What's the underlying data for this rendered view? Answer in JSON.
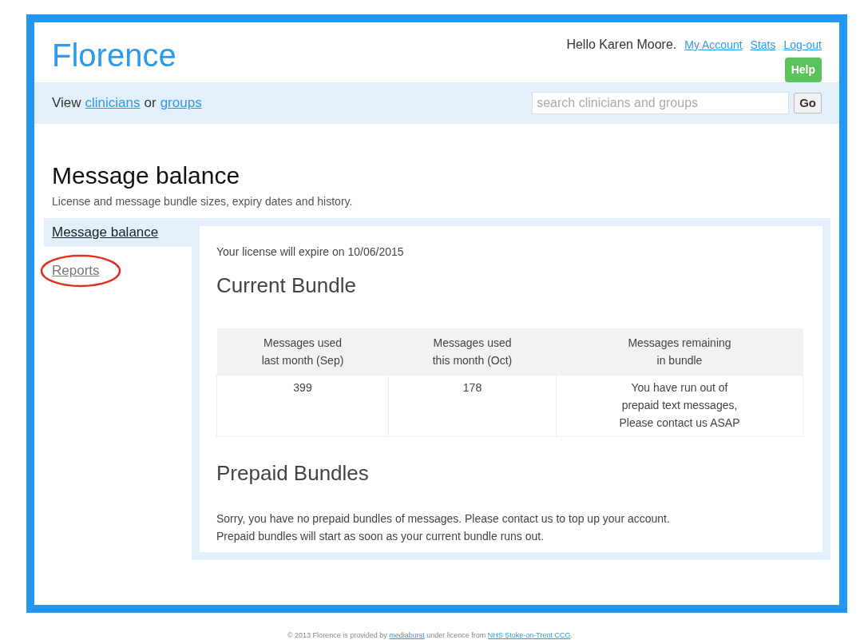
{
  "header": {
    "logo": "Florence",
    "greeting": "Hello Karen Moore.",
    "links": [
      "My Account",
      "Stats",
      "Log-out"
    ],
    "help_button": "Help"
  },
  "nav": {
    "prefix": "View",
    "link_1": "clinicians",
    "joiner": "or",
    "link_2": "groups",
    "search": {
      "placeholder": "search clinicians and groups"
    },
    "go_button": "Go"
  },
  "page": {
    "title": "Message balance",
    "subtitle": "License and message bundle sizes, expiry dates and history."
  },
  "sidebar": {
    "items": [
      {
        "label": "Message balance",
        "selected": true,
        "circled": false
      },
      {
        "label": "Reports",
        "selected": false,
        "circled": true
      }
    ]
  },
  "content": {
    "license_note": "Your license will expire on 10/06/2015",
    "current_heading": "Current Bundle",
    "table": {
      "columns": [
        "Messages used\nlast month (Sep)",
        "Messages used\nthis month (Oct)",
        "Messages remaining\nin bundle"
      ],
      "rows": [
        [
          "399",
          "178",
          "You have run out of\nprepaid text messages,\nPlease contact us ASAP"
        ]
      ]
    },
    "prepaid_heading": "Prepaid Bundles",
    "prepaid_text": "Sorry, you have no prepaid bundles of messages. Please contact us to top up your account.\nPrepaid bundles will start as soon as your current bundle runs out."
  },
  "footer": {
    "text_1": "© 2013 Florence is provided by",
    "link_1": "mediaburst",
    "text_2": "under licence from",
    "link_2": "NHS Stoke-on-Trent CCG",
    "text_3": "."
  }
}
